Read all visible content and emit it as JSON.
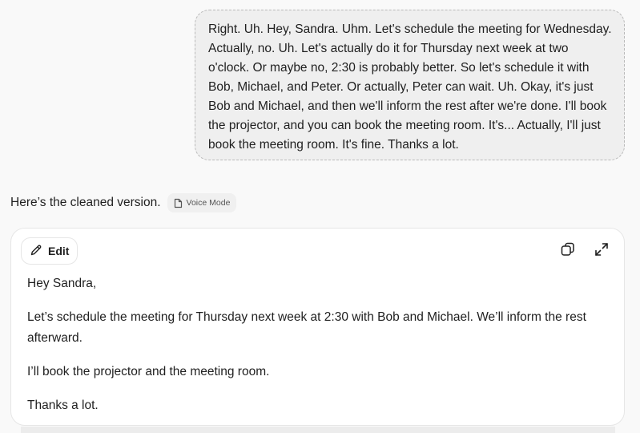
{
  "user_message": {
    "text": "Right. Uh. Hey, Sandra. Uhm. Let's schedule the meeting for Wednesday. Actually, no. Uh. Let's actually do it for Thursday next week at two o'clock. Or maybe no, 2:30 is probably better. So let's schedule it with Bob, Michael, and Peter. Or actually, Peter can wait. Uh. Okay, it's just Bob and Michael, and then we'll inform the rest after we're done. I'll book the projector, and you can book the meeting room. It's... Actually, I'll just book the meeting room. It's fine. Thanks a lot."
  },
  "assistant": {
    "intro": "Here’s the cleaned version.",
    "voice_chip_label": "Voice Mode",
    "voice_chip_icon": "document-icon"
  },
  "document": {
    "edit_label": "Edit",
    "edit_icon": "pencil-icon",
    "tools": [
      "copy-icon",
      "expand-icon"
    ],
    "paragraphs": [
      "Hey Sandra,",
      "Let’s schedule the meeting for Thursday next week at 2:30 with Bob and Michael. We’ll inform the rest afterward.",
      "I’ll book the projector and the meeting room.",
      "Thanks a lot."
    ]
  }
}
